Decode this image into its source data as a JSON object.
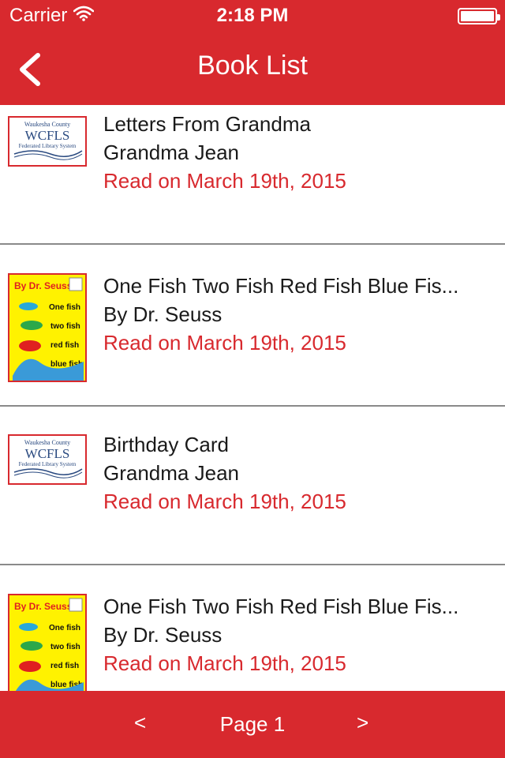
{
  "status_bar": {
    "carrier": "Carrier",
    "time": "2:18 PM"
  },
  "nav": {
    "title": "Book List"
  },
  "books": [
    {
      "title": "Letters From Grandma",
      "author": "Grandma Jean",
      "read": "Read on March 19th, 2015",
      "cover": "wcfls",
      "cover_text": [
        "Waukesha County",
        "WCFLS",
        "Federated Library System"
      ]
    },
    {
      "title": "One Fish Two Fish Red Fish Blue Fis...",
      "author": "By Dr. Seuss",
      "read": "Read on March 19th, 2015",
      "cover": "seuss",
      "cover_text": [
        "By Dr. Seuss",
        "One fish",
        "two fish",
        "red fish",
        "blue fish"
      ]
    },
    {
      "title": "Birthday Card",
      "author": "Grandma Jean",
      "read": "Read on March 19th, 2015",
      "cover": "wcfls",
      "cover_text": [
        "Waukesha County",
        "WCFLS",
        "Federated Library System"
      ]
    },
    {
      "title": "One Fish Two Fish Red Fish Blue Fis...",
      "author": "By Dr. Seuss",
      "read": "Read on March 19th, 2015",
      "cover": "seuss",
      "cover_text": [
        "By Dr. Seuss",
        "One fish",
        "two fish",
        "red fish",
        "blue fish"
      ]
    }
  ],
  "footer": {
    "prev_label": "<",
    "page_label": "Page 1",
    "next_label": ">"
  },
  "colors": {
    "accent": "#d8292e",
    "text": "#1a1a1a",
    "divider": "#8a8a8a"
  },
  "icons": {
    "wifi": "wifi-icon",
    "battery": "battery-icon",
    "back": "chevron-left-icon"
  }
}
